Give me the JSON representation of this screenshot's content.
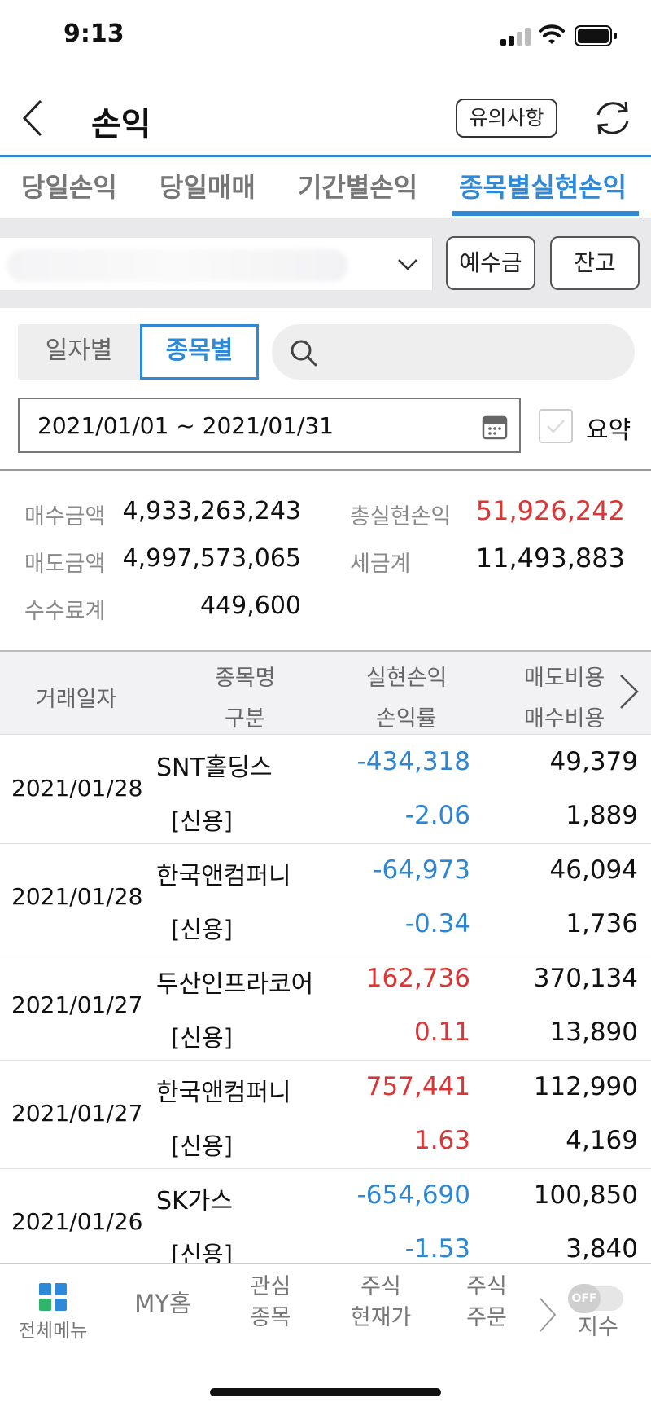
{
  "status_bar": {
    "time": "9:13"
  },
  "header": {
    "title": "손익",
    "notice_label": "유의사항"
  },
  "tabs": [
    {
      "label": "당일손익",
      "active": false
    },
    {
      "label": "당일매매",
      "active": false
    },
    {
      "label": "기간별손익",
      "active": false
    },
    {
      "label": "종목별실현손익",
      "active": true
    }
  ],
  "account": {
    "deposit_label": "예수금",
    "balance_label": "잔고"
  },
  "filter": {
    "by_date_label": "일자별",
    "by_item_label": "종목별",
    "date_range": "2021/01/01 ~ 2021/01/31",
    "summary_label": "요약"
  },
  "summary": {
    "buy_amount_label": "매수금액",
    "buy_amount": "4,933,263,243",
    "sell_amount_label": "매도금액",
    "sell_amount": "4,997,573,065",
    "fee_label": "수수료계",
    "fee": "449,600",
    "total_pl_label": "총실현손익",
    "total_pl": "51,926,242",
    "tax_label": "세금계",
    "tax": "11,493,883"
  },
  "table": {
    "headers": {
      "trade_date": "거래일자",
      "item_name": "종목명",
      "category": "구분",
      "realized_pl": "실현손익",
      "pl_rate": "손익률",
      "sell_cost": "매도비용",
      "buy_cost": "매수비용"
    },
    "rows": [
      {
        "date": "2021/01/28",
        "name": "SNT홀딩스",
        "kind": "[신용]",
        "pl": "-434,318",
        "rate": "-2.06",
        "sell_cost": "49,379",
        "buy_cost": "1,889",
        "sign": "neg"
      },
      {
        "date": "2021/01/28",
        "name": "한국앤컴퍼니",
        "kind": "[신용]",
        "pl": "-64,973",
        "rate": "-0.34",
        "sell_cost": "46,094",
        "buy_cost": "1,736",
        "sign": "neg"
      },
      {
        "date": "2021/01/27",
        "name": "두산인프라코어",
        "kind": "[신용]",
        "pl": "162,736",
        "rate": "0.11",
        "sell_cost": "370,134",
        "buy_cost": "13,890",
        "sign": "pos"
      },
      {
        "date": "2021/01/27",
        "name": "한국앤컴퍼니",
        "kind": "[신용]",
        "pl": "757,441",
        "rate": "1.63",
        "sell_cost": "112,990",
        "buy_cost": "4,169",
        "sign": "pos"
      },
      {
        "date": "2021/01/26",
        "name": "SK가스",
        "kind": "[신용]",
        "pl": "-654,690",
        "rate": "-1.53",
        "sell_cost": "100,850",
        "buy_cost": "3,840",
        "sign": "neg"
      }
    ]
  },
  "bottom_nav": {
    "all_menu": "전체메뉴",
    "my_home": "MY홈",
    "watch_line1": "관심",
    "watch_line2": "종목",
    "price_line1": "주식",
    "price_line2": "현재가",
    "order_line1": "주식",
    "order_line2": "주문",
    "toggle_text": "OFF",
    "index": "지수"
  },
  "colors": {
    "accent": "#2e89d8",
    "positive": "#d93636",
    "negative": "#2f86d0"
  }
}
